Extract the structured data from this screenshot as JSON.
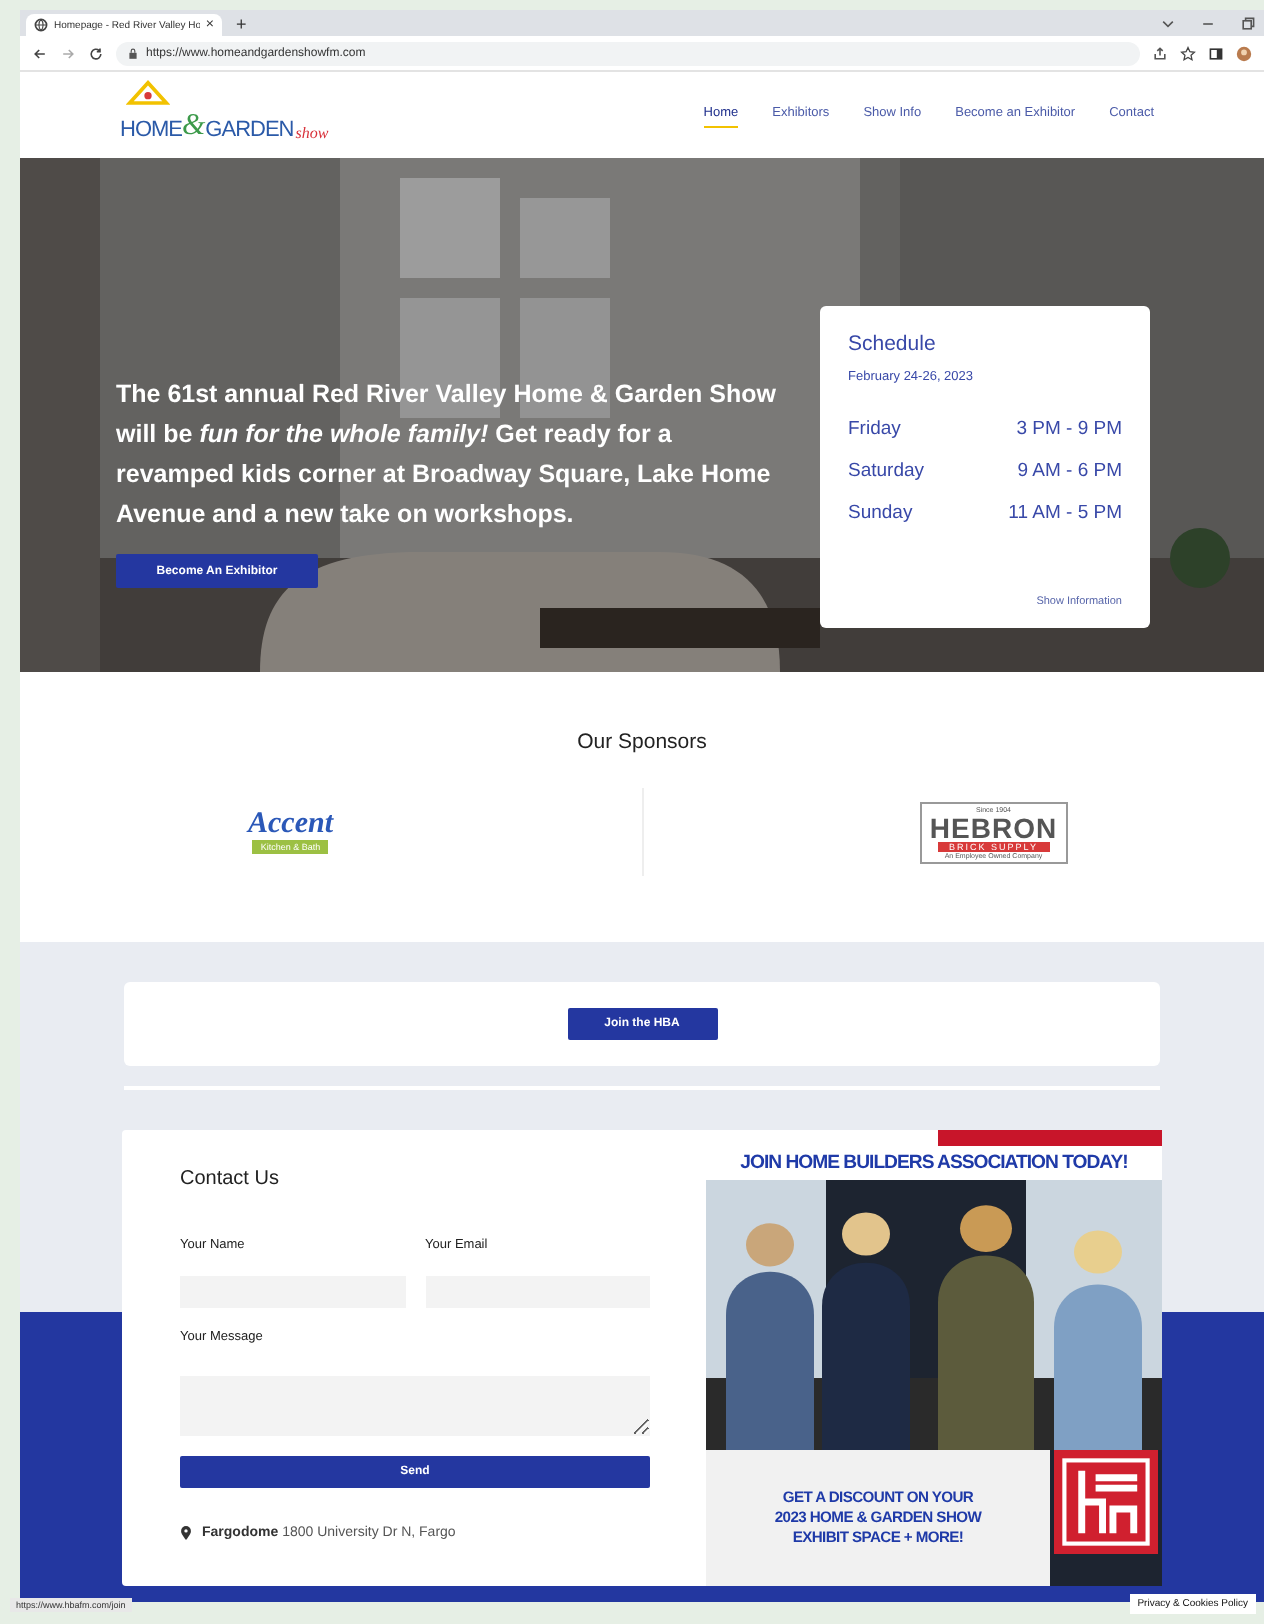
{
  "browser": {
    "tab_title": "Homepage - Red River Valley Ho",
    "tab_close": "×",
    "new_tab": "+",
    "url": "https://www.homeandgardenshowfm.com"
  },
  "logo": {
    "home": "HOME",
    "amp": "&",
    "garden": "GARDEN",
    "show": "show"
  },
  "nav": [
    {
      "label": "Home",
      "selected": true
    },
    {
      "label": "Exhibitors",
      "selected": false
    },
    {
      "label": "Show Info",
      "selected": false
    },
    {
      "label": "Become an Exhibitor",
      "selected": false
    },
    {
      "label": "Contact",
      "selected": false
    }
  ],
  "hero": {
    "text": "The 61st annual Red River Valley Home & Garden Show will be *fun for the whole family!* Get ready for a revamped kids corner at Broadway Square, Lake Home Avenue and a new take on workshops.",
    "button": "Become An Exhibitor"
  },
  "schedule": {
    "title": "Schedule",
    "dates": "February 24-26, 2023",
    "days": [
      {
        "day": "Friday",
        "hours": "3 PM - 9 PM"
      },
      {
        "day": "Saturday",
        "hours": "9 AM - 6 PM"
      },
      {
        "day": "Sunday",
        "hours": "11 AM - 5 PM"
      }
    ],
    "link": "Show Information"
  },
  "sponsors": {
    "title": "Our Sponsors",
    "logos": [
      {
        "kind": "accent",
        "name": "Accent",
        "tagline": "Kitchen & Bath"
      },
      {
        "kind": "hebron",
        "since": "Since 1904",
        "name": "HEBRON",
        "sub": "BRICK SUPPLY",
        "tagline": "An Employee Owned Company"
      }
    ]
  },
  "join": {
    "button": "Join the HBA"
  },
  "contact": {
    "title": "Contact Us",
    "name_label": "Your Name",
    "email_label": "Your Email",
    "message_label": "Your Message",
    "button": "Send",
    "address": "**Fargodome** 1800 University Dr N, Fargo"
  },
  "ad": {
    "headline": "JOIN HOME BUILDERS ASSOCIATION TODAY!",
    "offer_lines": [
      "GET A DISCOUNT ON YOUR",
      "2023 HOME & GARDEN SHOW",
      "EXHIBIT SPACE + MORE!"
    ]
  },
  "status_url": "https://www.hbafm.com/join",
  "cookie_link": "Privacy & Cookies Policy"
}
